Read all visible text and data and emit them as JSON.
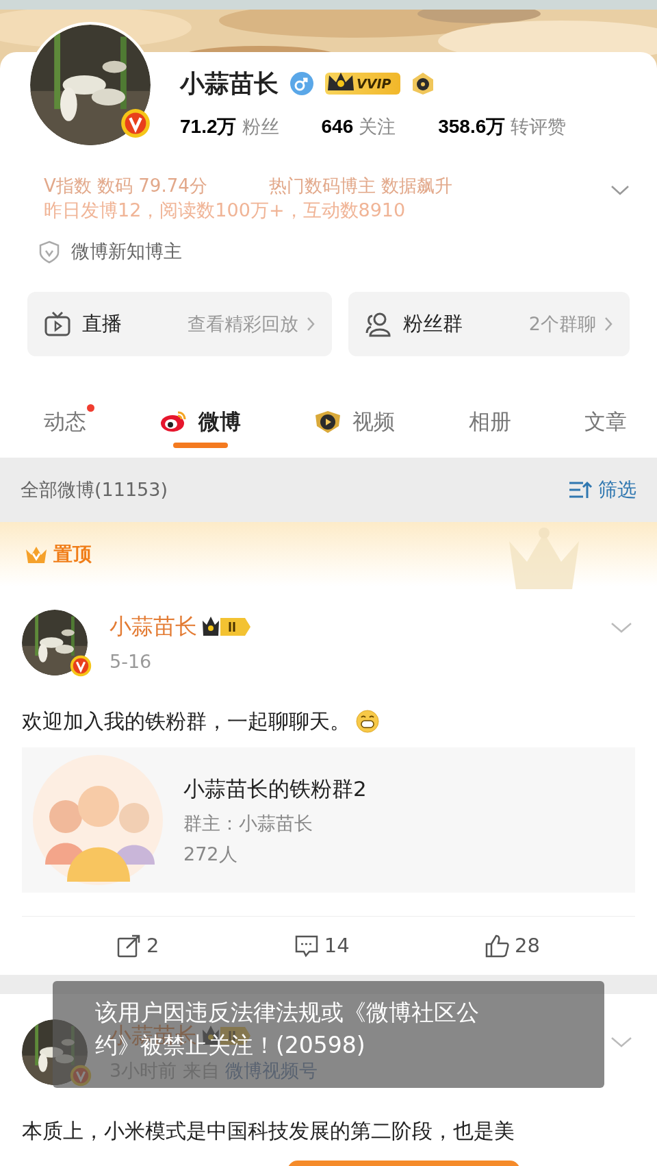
{
  "profile": {
    "name": "小蒜苗长",
    "vip_label": "VVIP",
    "stats": [
      {
        "value": "71.2万",
        "label": "粉丝"
      },
      {
        "value": "646",
        "label": "关注"
      },
      {
        "value": "358.6万",
        "label": "转评赞"
      }
    ],
    "faded_lines": [
      "V指数 数码 79.74分",
      "热门数码博主 数据飙升"
    ],
    "summary": "昨日发博12，阅读数100万+，互动数8910",
    "badge": "微博新知博主"
  },
  "shortcuts": [
    {
      "kind": "live",
      "title": "直播",
      "detail": "查看精彩回放"
    },
    {
      "kind": "fans",
      "title": "粉丝群",
      "detail": "2个群聊"
    }
  ],
  "tabs": [
    {
      "label": "动态",
      "has_new": true,
      "selected": false
    },
    {
      "label": "微博",
      "has_new": false,
      "selected": true
    },
    {
      "label": "视频",
      "has_new": false,
      "selected": false
    },
    {
      "label": "相册",
      "has_new": false,
      "selected": false
    },
    {
      "label": "文章",
      "has_new": false,
      "selected": false
    }
  ],
  "filter_bar": {
    "title": "全部微博(11153)",
    "action": "筛选"
  },
  "pinned_label": "置顶",
  "posts": [
    {
      "author": "小蒜苗长",
      "meta": "5-16",
      "text": "欢迎加入我的铁粉群，一起聊聊天。",
      "emoji": true,
      "card": {
        "title": "小蒜苗长的铁粉群2",
        "owner": "群主：小蒜苗长",
        "members": "272人"
      },
      "actions": [
        {
          "kind": "repost",
          "count": "2"
        },
        {
          "kind": "comment",
          "count": "14"
        },
        {
          "kind": "like",
          "count": "28"
        }
      ]
    },
    {
      "author": "小蒜苗长",
      "meta": "3小时前  来自",
      "source": "微博视频号",
      "text": "本质上，小米模式是中国科技发展的第二阶段，也是美",
      "emoji": false
    }
  ],
  "toast": "该用户因违反法律法规或《微博社区公约》被禁止关注！(20598)"
}
